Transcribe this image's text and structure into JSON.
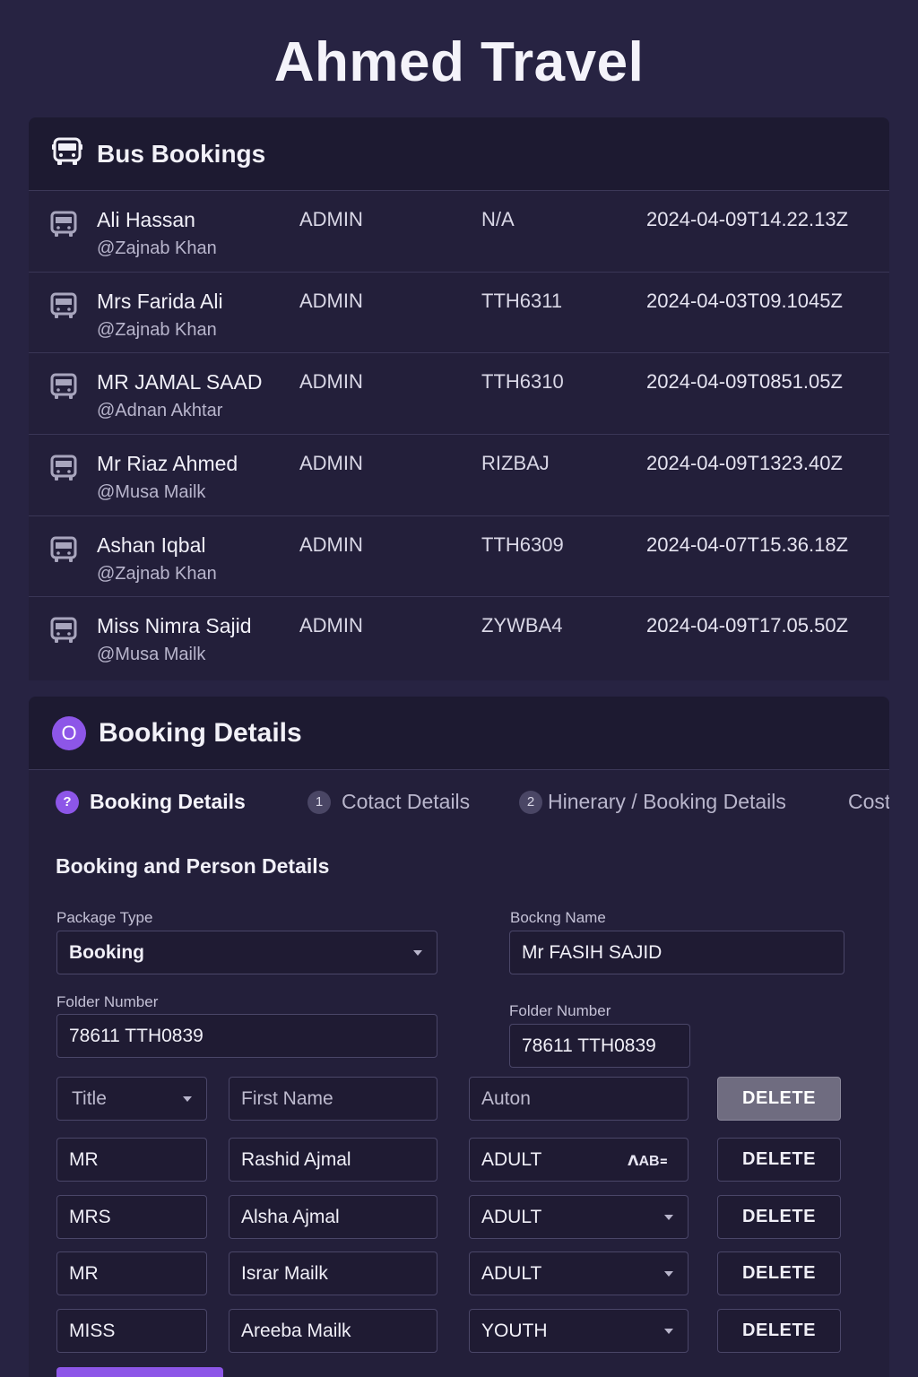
{
  "app": {
    "title": "Ahmed Travel"
  },
  "bus_bookings": {
    "title": "Bus Bookings",
    "rows": [
      {
        "name": "Ali Hassan",
        "user": "@Zajnab Khan",
        "role": "ADMIN",
        "ref": "N/A",
        "date": "2024-04-09T14.22.13Z"
      },
      {
        "name": "Mrs Farida Ali",
        "user": "@Zajnab Khan",
        "role": "ADMIN",
        "ref": "TTH6311",
        "date": "2024-04-03T09.1045Z"
      },
      {
        "name": "MR JAMAL SAAD",
        "user": "@Adnan Akhtar",
        "role": "ADMIN",
        "ref": "TTH6310",
        "date": "2024-04-09T0851.05Z"
      },
      {
        "name": "Mr Riaz Ahmed",
        "user": "@Musa Mailk",
        "role": "ADMIN",
        "ref": "RIZBAJ",
        "date": "2024-04-09T1323.40Z"
      },
      {
        "name": "Ashan Iqbal",
        "user": "@Zajnab Khan",
        "role": "ADMIN",
        "ref": "TTH6309",
        "date": "2024-04-07T15.36.18Z"
      },
      {
        "name": "Miss Nimra Sajid",
        "user": "@Musa Mailk",
        "role": "ADMIN",
        "ref": "ZYWBA4",
        "date": "2024-04-09T17.05.50Z"
      }
    ]
  },
  "booking_details": {
    "icon_letter": "O",
    "title": "Booking Details",
    "steps": [
      {
        "num": "?",
        "label": "Booking Details"
      },
      {
        "num": "1",
        "label": "Cotact Details"
      },
      {
        "num": "2",
        "label": "Hinerary / Booking Details"
      },
      {
        "num": "",
        "label": "Cost"
      }
    ],
    "section_title": "Booking and Person Details",
    "package_type": {
      "label": "Package Type",
      "value": "Booking"
    },
    "booking_name": {
      "label": "Bockng Name",
      "value": "Mr FASIH SAJID"
    },
    "folder_number_left": {
      "label": "Folder Number",
      "value": "78611 TTH0839"
    },
    "folder_number_right": {
      "label": "Folder Number",
      "value": "78611 TTH0839"
    },
    "header_row": {
      "title": "Title",
      "first_name": "First Name",
      "type": "Auton",
      "delete": "DELETE"
    },
    "passengers": [
      {
        "title": "MR",
        "first_name": "Rashid Ajmal",
        "type": "ADULT",
        "delete": "DELETE",
        "badge": "ꓥAB꓿"
      },
      {
        "title": "MRS",
        "first_name": "Alsha Ajmal",
        "type": "ADULT",
        "delete": "DELETE"
      },
      {
        "title": "MR",
        "first_name": "Israr Mailk",
        "type": "ADULT",
        "delete": "DELETE"
      },
      {
        "title": "MISS",
        "first_name": "Areeba Mailk",
        "type": "YOUTH",
        "delete": "DELETE"
      }
    ]
  },
  "colors": {
    "accent": "#8d56e8",
    "background": "#272342",
    "panel": "#231f3a"
  }
}
